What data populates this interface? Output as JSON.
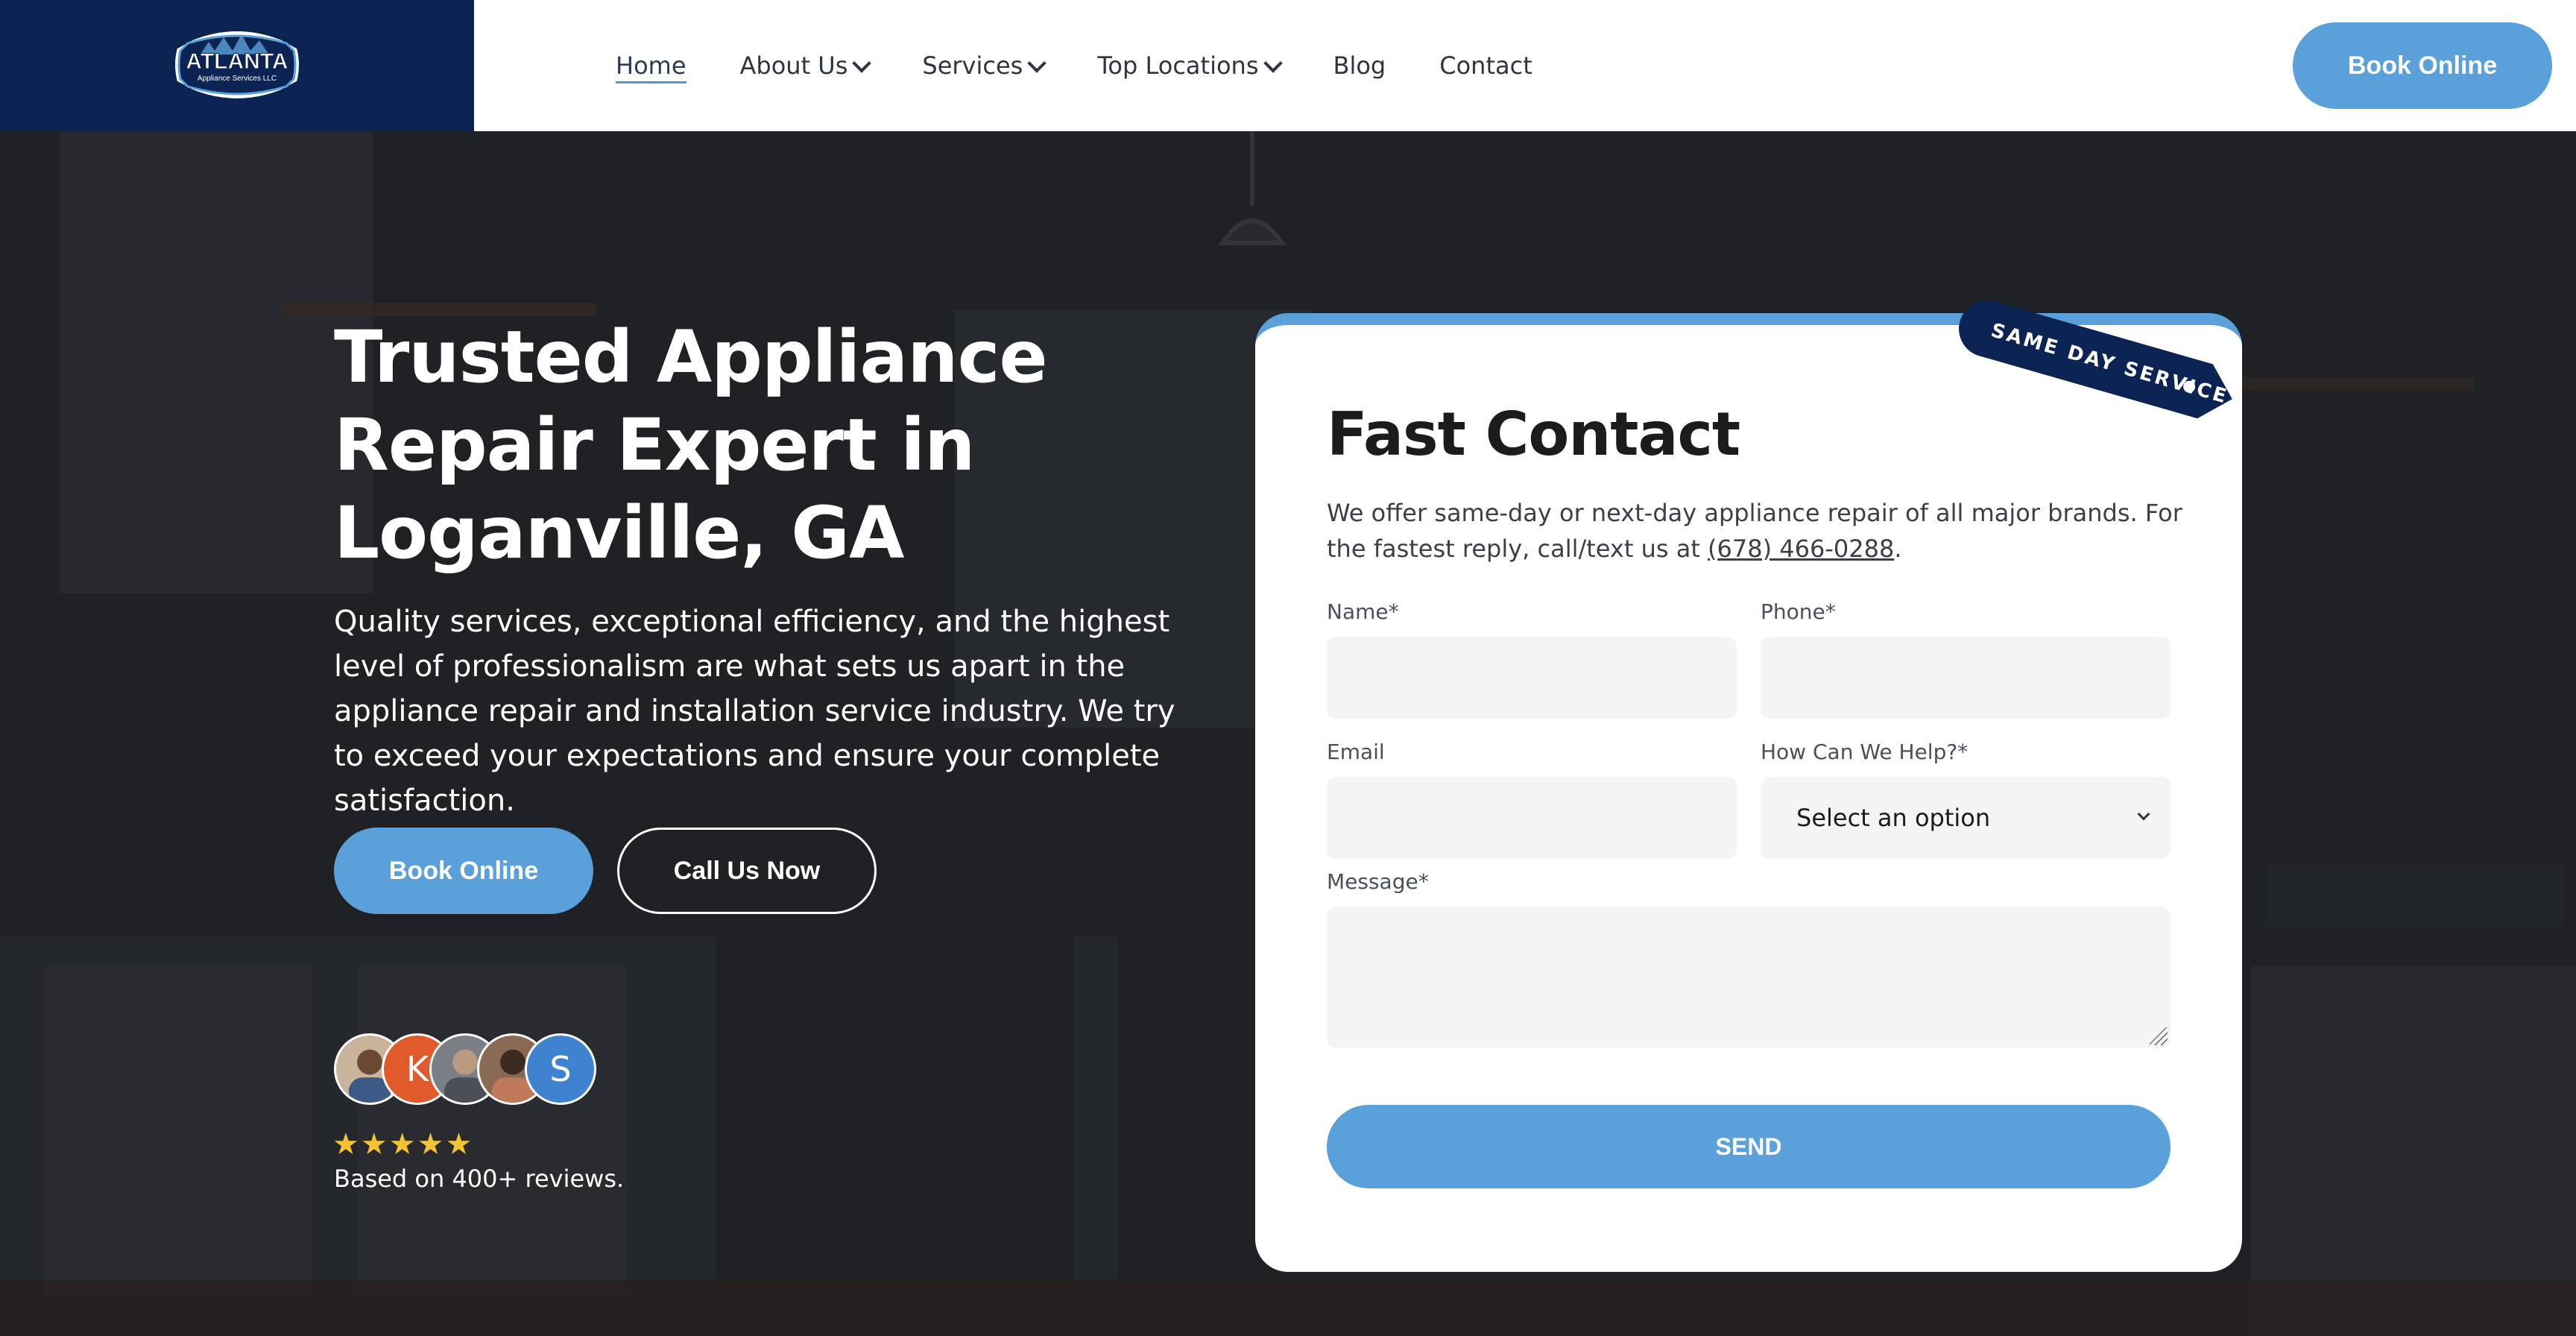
{
  "header": {
    "logo_text": "ATLANTA",
    "logo_subtext": "Appliance Services LLC",
    "nav": [
      {
        "label": "Home",
        "has_dropdown": false,
        "active": true
      },
      {
        "label": "About Us",
        "has_dropdown": true
      },
      {
        "label": "Services",
        "has_dropdown": true
      },
      {
        "label": "Top Locations",
        "has_dropdown": true
      },
      {
        "label": "Blog",
        "has_dropdown": false
      },
      {
        "label": "Contact",
        "has_dropdown": false
      }
    ],
    "book_label": "Book Online"
  },
  "hero": {
    "title": "Trusted Appliance Repair Expert in Loganville, GA",
    "subtitle": "Quality services, exceptional efficiency, and the highest level of professionalism are what sets us apart in the appliance repair and installation service industry. We try to exceed your expectations and ensure your complete satisfaction.",
    "book_label": "Book Online",
    "call_label": "Call Us Now",
    "avatars": [
      "",
      "K",
      "",
      "",
      "S"
    ],
    "stars": "★★★★★",
    "rating": 5,
    "reviews_text": "Based on 400+ reviews."
  },
  "form": {
    "ribbon": "SAME DAY SERVICE",
    "title": "Fast Contact",
    "desc_prefix": "We offer same-day or next-day appliance repair of all major brands. For the fastest reply, call/text us at ",
    "phone": "(678) 466-0288",
    "desc_suffix": ".",
    "name_label": "Name*",
    "phone_label": "Phone*",
    "email_label": "Email",
    "help_label": "How Can We Help?*",
    "help_selected": "Select an option",
    "message_label": "Message*",
    "send_label": "SEND"
  },
  "colors": {
    "navy": "#0c2454",
    "accent": "#5aa0da",
    "star": "#f5c331",
    "field_bg": "#f4f4f5"
  }
}
